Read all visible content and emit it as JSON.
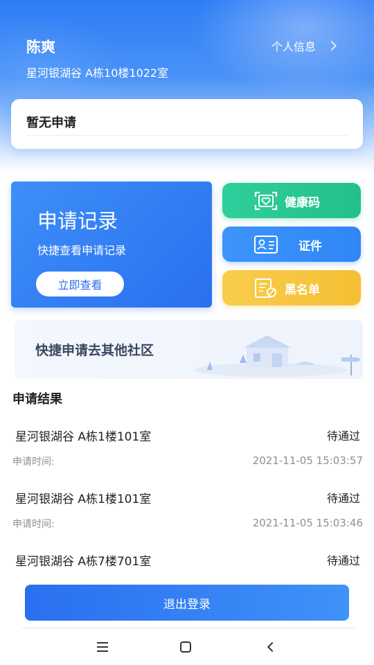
{
  "header": {
    "user_name": "陈爽",
    "address": "星河银湖谷 A栋10楼1022室",
    "profile_link": "个人信息"
  },
  "status_card": {
    "title": "暂无申请"
  },
  "records_card": {
    "title": "申请记录",
    "subtitle": "快捷查看申请记录",
    "button": "立即查看"
  },
  "actions": {
    "health_code": "健康码",
    "certificate": "证件",
    "blacklist": "黑名单"
  },
  "community": {
    "text": "快捷申请去其他社区"
  },
  "results": {
    "title": "申请结果",
    "time_label": "申请时间:",
    "items": [
      {
        "address": "星河银湖谷 A栋1楼101室",
        "status": "待通过",
        "time": "2021-11-05 15:03:57"
      },
      {
        "address": "星河银湖谷 A栋1楼101室",
        "status": "待通过",
        "time": "2021-11-05 15:03:46"
      },
      {
        "address": "星河银湖谷 A栋7楼701室",
        "status": "待通过"
      }
    ]
  },
  "logout": "退出登录",
  "colors": {
    "primary": "#2a6ff0",
    "health": "#22c08a",
    "certificate": "#2f86f6",
    "blacklist": "#f5bf34"
  }
}
